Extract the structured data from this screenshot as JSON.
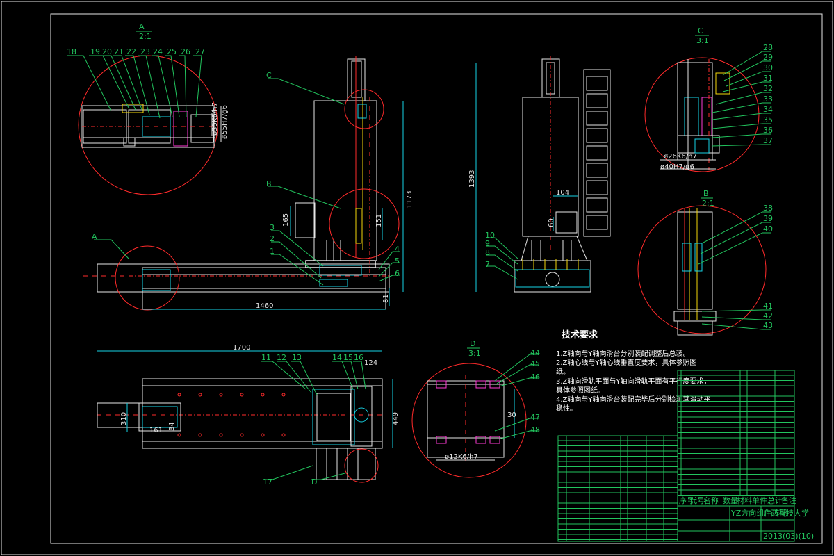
{
  "views": {
    "A": {
      "label": "A",
      "scale": "2:1"
    },
    "B": {
      "label": "B",
      "scale": "2:1"
    },
    "C": {
      "label": "C",
      "scale": "3:1"
    },
    "D": {
      "label": "D",
      "scale": "3:1"
    }
  },
  "callouts_main": {
    "A": "A",
    "B": "B",
    "C": "C",
    "D": "D"
  },
  "dimensions": {
    "d1460": "1460",
    "d1700": "1700",
    "d1173": "1173",
    "d1393": "1393",
    "d165": "165",
    "d151": "151",
    "d104": "104",
    "d60": "60",
    "d81": "81",
    "d124": "124",
    "d449": "449",
    "d310": "310",
    "d161": "161",
    "d34": "34",
    "d30": "30",
    "fitA1": "ø35K6/h7",
    "fitA2": "ø55H7/g6",
    "fitC1": "ø26K6/h7",
    "fitC2": "ø40H7/g6",
    "fitD": "ø12K6/h7"
  },
  "parts": [
    "1",
    "2",
    "3",
    "4",
    "5",
    "6",
    "7",
    "8",
    "9",
    "10",
    "11",
    "12",
    "13",
    "14",
    "15",
    "16",
    "17",
    "18",
    "19",
    "20",
    "21",
    "22",
    "23",
    "24",
    "25",
    "26",
    "27",
    "28",
    "29",
    "30",
    "31",
    "32",
    "33",
    "34",
    "35",
    "36",
    "37",
    "38",
    "39",
    "40",
    "41",
    "42",
    "43",
    "44",
    "45",
    "46",
    "47",
    "48"
  ],
  "requirements": {
    "title": "技术要求",
    "items": [
      "1.Z轴向与Y轴向滑台分别装配调整后总装。",
      "2.Z轴心线与Y轴心线垂直度要求，具体参照图",
      "纸。",
      "3.Z轴向滑轨平面与Y轴向滑轨平面有平行度要求，",
      "具体参照图纸。",
      "4.Z轴向与Y轴向滑台装配完毕后分别检测其滑动平",
      "稳性。"
    ]
  },
  "title_block": {
    "drawing_name": "YZ方向组件装配",
    "school": "广西科技大学",
    "drawing_no": "2013(03)(10)",
    "header_cols": [
      "序号",
      "代号",
      "名称",
      "数量",
      "材料",
      "单件",
      "总计",
      "备注"
    ]
  }
}
